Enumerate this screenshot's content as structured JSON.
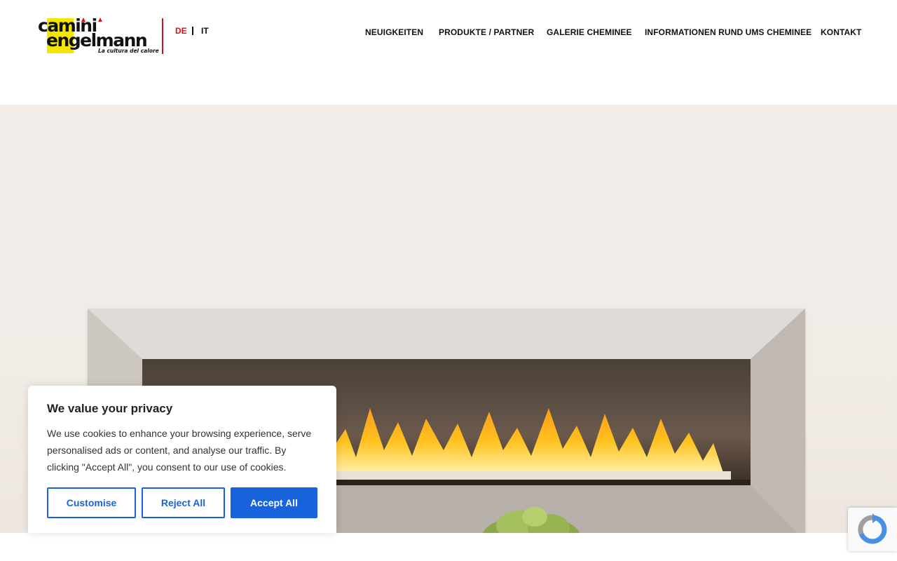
{
  "logo": {
    "line1": "camini",
    "line2": "engelmann",
    "tagline": "La cultura del calore",
    "brand_yellow": "#f5e600",
    "brand_red": "#d2121c"
  },
  "languages": {
    "active": "DE",
    "other": "IT"
  },
  "nav": [
    "NEUIGKEITEN",
    "PRODUKTE / PARTNER",
    "GALERIE CHEMINEE",
    "INFORMATIONEN RUND UMS CHEMINEE",
    "KONTAKT"
  ],
  "cookie_banner": {
    "title": "We value your privacy",
    "text": "We use cookies to enhance your browsing experience, serve personalised ads or content, and analyse our traffic. By clicking \"Accept All\", you consent to our use of cookies.",
    "customise": "Customise",
    "reject": "Reject All",
    "accept": "Accept All",
    "accent": "#1863dc"
  },
  "icons": {
    "recaptcha": "recaptcha-icon"
  }
}
